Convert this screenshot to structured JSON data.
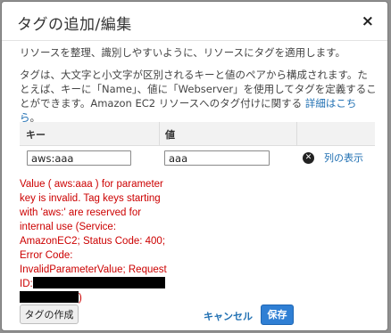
{
  "dialog": {
    "title": "タグの追加/編集",
    "close_glyph": "×"
  },
  "description": {
    "line1": "リソースを整理、識別しやすいように、リソースにタグを適用します。",
    "line2_text": "タグは、大文字と小文字が区別されるキーと値のペアから構成されます。たとえば、キーに「Name」、値に「Webserver」を使用してタグを定義することができます。Amazon EC2 リソースへのタグ付けに関する",
    "line2_link": "詳細はこちら",
    "line2_end": "。"
  },
  "table": {
    "header_key": "キー",
    "header_value": "値",
    "rows": [
      {
        "key": "aws:aaa",
        "value": "aaa"
      }
    ],
    "show_columns_label": "列の表示",
    "remove_glyph": "✕"
  },
  "error": {
    "lines": [
      "Value ( aws:aaa ) for parameter",
      "key is invalid. Tag keys starting",
      "with 'aws:' are reserved for",
      "internal use (Service:",
      "AmazonEC2; Status Code: 400;",
      "Error Code:",
      "InvalidParameterValue; Request"
    ],
    "request_id_label": "ID:",
    "closing_paren": ")"
  },
  "buttons": {
    "add_tag": "タグの作成",
    "cancel": "キャンセル",
    "save": "保存"
  },
  "colors": {
    "link": "#1f6fb2",
    "error": "#cc0000",
    "primary_button": "#2f7fd4"
  }
}
